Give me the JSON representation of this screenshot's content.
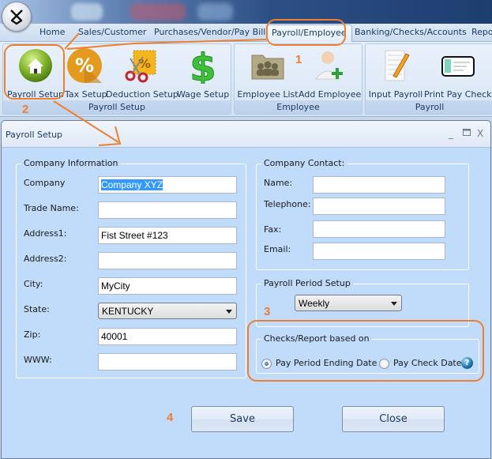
{
  "app": {
    "orb_icon": "app-logo-icon",
    "tabs": [
      {
        "label": "Home",
        "active": false
      },
      {
        "label": "Sales/Customer",
        "active": false
      },
      {
        "label": "Purchases/Vendor/Pay Bill",
        "active": false
      },
      {
        "label": "Payroll/Employee",
        "active": true
      },
      {
        "label": "Banking/Checks/Accounts",
        "active": false
      },
      {
        "label": "Repo",
        "active": false
      }
    ]
  },
  "ribbon": {
    "groups": [
      {
        "label": "Payroll Setup",
        "buttons": [
          {
            "label": "Payroll Setup",
            "icon": "house-icon"
          },
          {
            "label": "Tax Setup",
            "icon": "percent-icon"
          },
          {
            "label": "Deduction Setup",
            "icon": "scissors-coupon-icon"
          },
          {
            "label": "Wage Setup",
            "icon": "dollar-icon"
          }
        ]
      },
      {
        "label": "Employee",
        "buttons": [
          {
            "label": "Employee List",
            "icon": "folder-users-icon"
          },
          {
            "label": "Add Employee",
            "icon": "add-user-icon"
          }
        ]
      },
      {
        "label": "Payroll",
        "buttons": [
          {
            "label": "Input Payroll",
            "icon": "notepad-pencil-icon"
          },
          {
            "label": "Print Pay Checks",
            "icon": "check-icon"
          }
        ]
      }
    ]
  },
  "dialog": {
    "title": "Payroll Setup",
    "window_controls": {
      "minimize": "_",
      "maximize": "▭",
      "close": "X"
    },
    "company_info": {
      "legend": "Company Information",
      "fields": [
        {
          "label": "Company",
          "value": "Company XYZ",
          "selected": true
        },
        {
          "label": "Trade Name:",
          "value": ""
        },
        {
          "label": "Address1:",
          "value": "Fist Street #123"
        },
        {
          "label": "Address2:",
          "value": ""
        },
        {
          "label": "City:",
          "value": "MyCity"
        },
        {
          "label": "State:",
          "value": "KENTUCKY",
          "type": "select"
        },
        {
          "label": "Zip:",
          "value": "40001"
        },
        {
          "label": "WWW:",
          "value": ""
        }
      ]
    },
    "company_contact": {
      "legend": "Company Contact:",
      "fields": [
        {
          "label": "Name:",
          "value": ""
        },
        {
          "label": "Telephone:",
          "value": ""
        },
        {
          "label": "Fax:",
          "value": ""
        },
        {
          "label": "Email:",
          "value": ""
        }
      ]
    },
    "payroll_period": {
      "legend": "Payroll Period Setup",
      "value": "Weekly"
    },
    "checks_report": {
      "legend": "Checks/Report based on",
      "options": [
        {
          "label": "Pay Period Ending Date",
          "checked": true
        },
        {
          "label": "Pay Check Date",
          "checked": false
        }
      ],
      "help_icon": "?"
    },
    "buttons": {
      "save": "Save",
      "close": "Close"
    }
  },
  "annotations": {
    "color": "#ef7f2e",
    "steps": [
      "1",
      "2",
      "3",
      "4"
    ]
  }
}
